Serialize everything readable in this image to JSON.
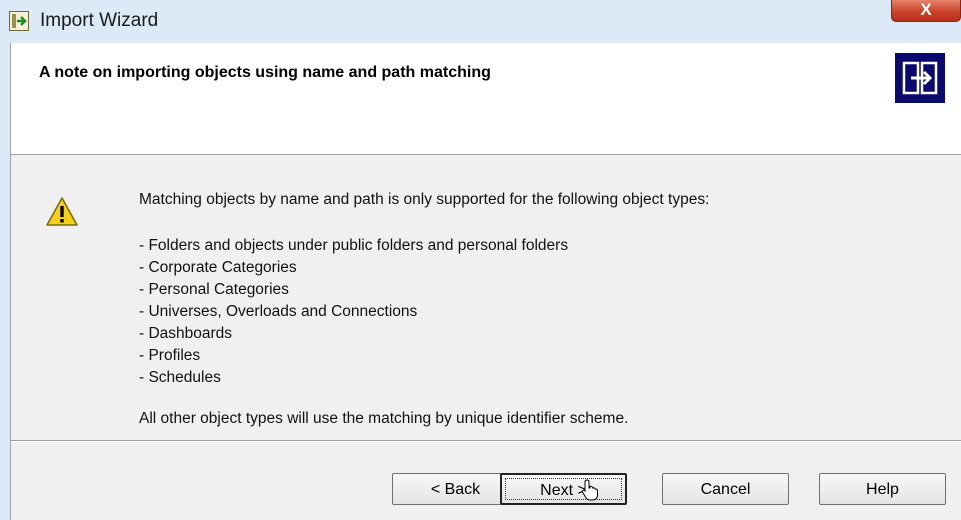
{
  "window": {
    "title": "Import Wizard",
    "close_label": "X"
  },
  "header": {
    "title": "A note on importing objects using name and path matching"
  },
  "body": {
    "intro": "Matching objects by name and path is only supported for the following object types:",
    "items": [
      "- Folders and objects under public folders and personal folders",
      "- Corporate Categories",
      "- Personal Categories",
      "- Universes, Overloads and Connections",
      "- Dashboards",
      "- Profiles",
      "- Schedules"
    ],
    "footer": "All other object types will use the matching by unique identifier scheme."
  },
  "buttons": {
    "back": "< Back",
    "next": "Next >",
    "cancel": "Cancel",
    "help": "Help"
  },
  "icons": {
    "app": "import-wizard-icon",
    "header": "import-export-icon",
    "warning": "warning-icon",
    "cursor": "hand-pointer-icon"
  },
  "colors": {
    "header_icon_bg": "#0a0a6e",
    "close_button": "#c9432a",
    "warning_yellow": "#f5d116"
  }
}
